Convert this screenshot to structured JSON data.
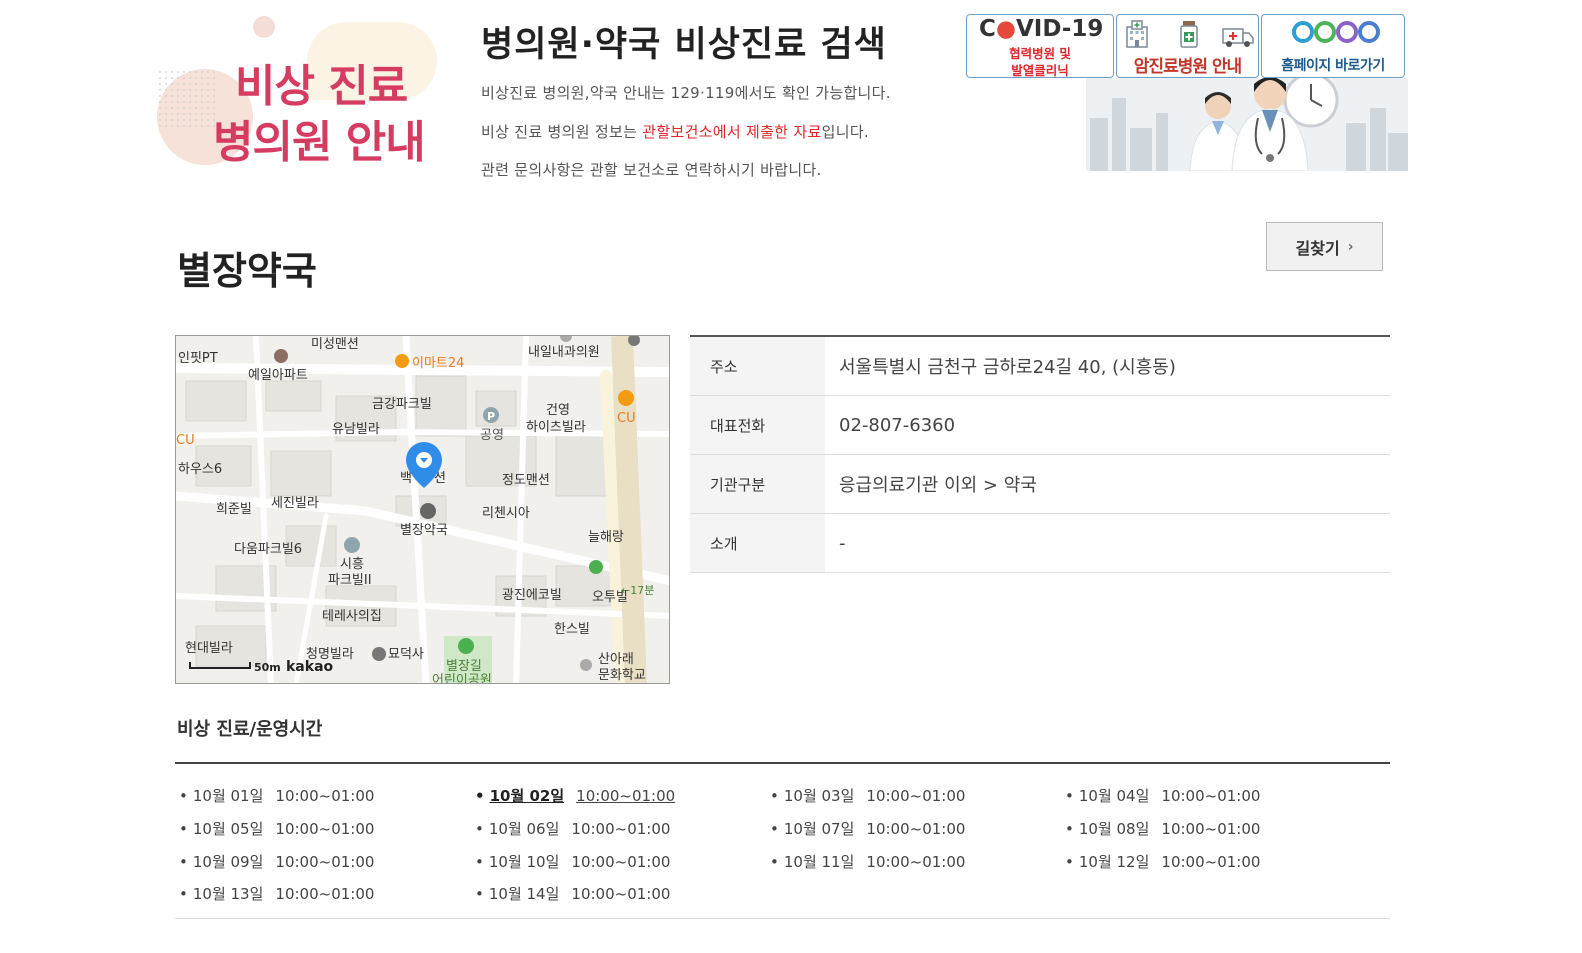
{
  "header": {
    "logo_line1": "비상 진료",
    "logo_line2": "병의원 안내",
    "title": "병의원·약국 비상진료 검색",
    "desc1": "비상진료 병의원,약국 안내는 129·119에서도 확인 가능합니다.",
    "desc2_pre": "비상 진료 병의원 정보는 ",
    "desc2_red": "관할보건소에서 제출한 자료",
    "desc2_post": "입니다.",
    "desc3": "관련 문의사항은 관할 보건소로 연락하시기 바랍니다."
  },
  "banners": {
    "covid_title_a": "C",
    "covid_title_o": "●",
    "covid_title_b": "VID-19",
    "covid_sub1": "협력병원 및",
    "covid_sub2": "발열클리닉",
    "cancer": "암진료병원 안내",
    "homepage": "홈페이지 바로가기"
  },
  "place": {
    "name": "별장약국",
    "route_button": "길찾기",
    "route_chevron": "›"
  },
  "map": {
    "pin_label": "별장약국",
    "scale": "50m",
    "brand": "kakao",
    "labels": [
      "인핏PT",
      "미성맨션",
      "예일아파트",
      "이마트24",
      "내일내과의원",
      "금강파크빌",
      "유남빌라",
      "공영",
      "건영",
      "하이츠빌라",
      "CU",
      "CU",
      "하우스6",
      "백",
      "션",
      "정도맨션",
      "희준빌",
      "세진빌라",
      "리첸시아",
      "늘해랑",
      "다움파크빌6",
      "시흥",
      "파크빌II",
      "←17분",
      "광진에코빌",
      "오투빌",
      "테레사의집",
      "한스빌",
      "현대빌라",
      "청명빌라",
      "묘덕사",
      "별장길",
      "어린이공원",
      "산아래",
      "문화학교",
      "P"
    ]
  },
  "info": [
    {
      "key": "주소",
      "value": "서울특별시 금천구 금하로24길 40, (시흥동)"
    },
    {
      "key": "대표전화",
      "value": "02-807-6360"
    },
    {
      "key": "기관구분",
      "value": "응급의료기관 이외 > 약국"
    },
    {
      "key": "소개",
      "value": "-"
    }
  ],
  "hours": {
    "title": "비상 진료/운영시간",
    "bullet": "•",
    "items": [
      {
        "date": "10월 01일",
        "time": "10:00~01:00"
      },
      {
        "date": "10월 02일",
        "time": "10:00~01:00",
        "active": true
      },
      {
        "date": "10월 03일",
        "time": "10:00~01:00"
      },
      {
        "date": "10월 04일",
        "time": "10:00~01:00"
      },
      {
        "date": "10월 05일",
        "time": "10:00~01:00"
      },
      {
        "date": "10월 06일",
        "time": "10:00~01:00"
      },
      {
        "date": "10월 07일",
        "time": "10:00~01:00"
      },
      {
        "date": "10월 08일",
        "time": "10:00~01:00"
      },
      {
        "date": "10월 09일",
        "time": "10:00~01:00"
      },
      {
        "date": "10월 10일",
        "time": "10:00~01:00"
      },
      {
        "date": "10월 11일",
        "time": "10:00~01:00"
      },
      {
        "date": "10월 12일",
        "time": "10:00~01:00"
      },
      {
        "date": "10월 13일",
        "time": "10:00~01:00"
      },
      {
        "date": "10월 14일",
        "time": "10:00~01:00"
      }
    ]
  },
  "colors": {
    "accent_red": "#e1262d",
    "logo_pink": "#d63b62",
    "map_pin": "#2f8de8",
    "poi_orange": "#f39c12"
  }
}
